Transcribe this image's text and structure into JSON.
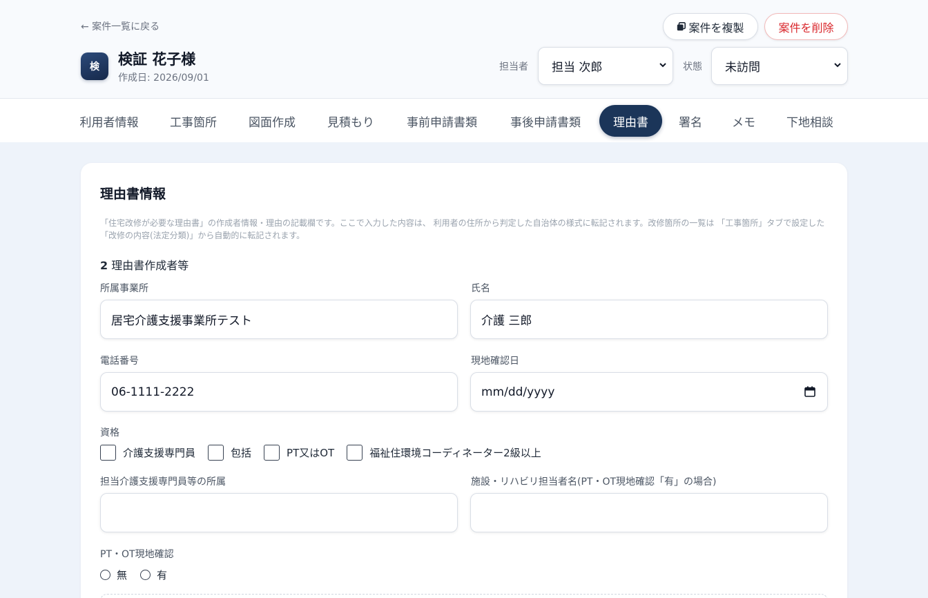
{
  "header": {
    "back_label": "← 案件一覧に戻る",
    "avatar_char": "検",
    "client_name": "検証 花子様",
    "created": "作成日: 2026/09/01",
    "duplicate_label": "案件を複製",
    "delete_label": "案件を削除",
    "assignee_label": "担当者",
    "assignee_value": "担当 次郎",
    "status_label": "状態",
    "status_value": "未訪問"
  },
  "tabs": [
    {
      "label": "利用者情報"
    },
    {
      "label": "工事箇所"
    },
    {
      "label": "図面作成"
    },
    {
      "label": "見積もり"
    },
    {
      "label": "事前申請書類"
    },
    {
      "label": "事後申請書類"
    },
    {
      "label": "理由書",
      "active": true
    },
    {
      "label": "署名"
    },
    {
      "label": "メモ"
    },
    {
      "label": "下地相談"
    }
  ],
  "card": {
    "title": "理由書情報",
    "description": "「住宅改修が必要な理由書」の作成者情報・理由の記載欄です。ここで入力した内容は、 利用者の住所から判定した自治体の様式に転記されます。改修箇所の一覧は 「工事箇所」タブで設定した「改修の内容(法定分類)」から自動的に転記されます。",
    "section_number": "2",
    "section_title": "理由書作成者等",
    "fields": {
      "office_label": "所属事業所",
      "office_value": "居宅介護支援事業所テスト",
      "name_label": "氏名",
      "name_value": "介護 三郎",
      "phone_label": "電話番号",
      "phone_value": "06-1111-2222",
      "visit_date_label": "現地確認日",
      "visit_date_placeholder": "mm/dd/yyyy",
      "qualification_label": "資格",
      "qualifications": [
        "介護支援専門員",
        "包括",
        "PT又はOT",
        "福祉住環境コーディネーター2級以上"
      ],
      "cm_affiliation_label": "担当介護支援専門員等の所属",
      "cm_affiliation_value": "",
      "facility_label": "施設・リハビリ担当者名(PT・OT現地確認「有」の場合)",
      "facility_value": "",
      "ptot_label": "PT・OT現地確認",
      "ptot_options": [
        "無",
        "有"
      ]
    }
  }
}
